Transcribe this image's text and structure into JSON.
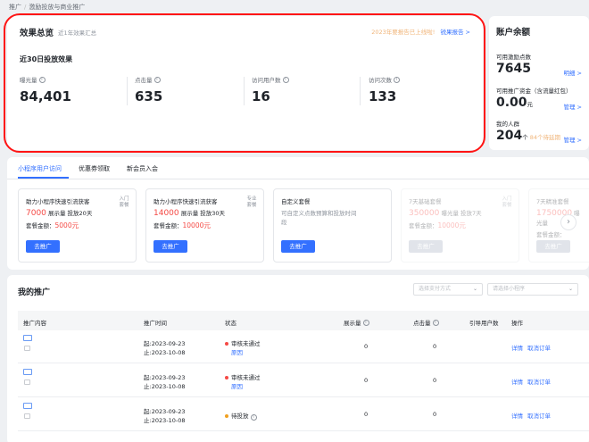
{
  "breadcrumb": {
    "root": "推广",
    "sep": "/",
    "current": "激励投放与商业推广"
  },
  "overview": {
    "title": "效果总览",
    "subtitle": "近1年效果汇总",
    "annual_tip": "2023年要报告已上线啦!",
    "annual_link": "锐果报告 >",
    "period_title": "近30日投放效果",
    "metrics": [
      {
        "label": "曝光量",
        "value": "84,401"
      },
      {
        "label": "点击量",
        "value": "635"
      },
      {
        "label": "访问用户数",
        "value": "16"
      },
      {
        "label": "访问次数",
        "value": "133"
      }
    ]
  },
  "balance": {
    "title": "账户余额",
    "points_label": "可用激励点数",
    "points_value": "7645",
    "points_link": "明细 >",
    "funds_label": "可用推广资金（含流量红包）",
    "funds_value": "0.00",
    "funds_unit": "元",
    "funds_link": "管理 >",
    "invites_label": "我的人群",
    "invites_value": "204",
    "invites_unit": "个",
    "invites_pending": "84个待延期",
    "invites_link": "管理 >"
  },
  "promo_tabs": {
    "tabs": [
      "小程序用户访问",
      "优惠券领取",
      "新会员入会"
    ]
  },
  "packages": [
    {
      "title": "助力小程序快速引流获客",
      "tag": "入门套餐",
      "views": "7000",
      "views_suffix": "展示量 投放20天",
      "amount_label": "套餐金额：",
      "amount": "5000元",
      "button": "去推广"
    },
    {
      "title": "助力小程序快速引流获客",
      "tag": "专业套餐",
      "views": "14000",
      "views_suffix": "展示量 投放30天",
      "amount_label": "套餐金额：",
      "amount": "10000元",
      "button": "去推广"
    },
    {
      "title": "自定义套餐",
      "desc": "可自定义点数预算和投放时间段",
      "button": "去推广"
    },
    {
      "title": "7天基础套餐",
      "tag": "入门套餐",
      "views": "350000",
      "views_suffix": "曝光量 投放7天",
      "amount_label": "套餐金额：",
      "amount": "10000元",
      "button": "去推广"
    },
    {
      "title": "7天精准套餐",
      "views": "1750000",
      "views_suffix": "曝光量",
      "amount_label": "套餐金额：",
      "amount": "",
      "button": "去推广"
    }
  ],
  "my_promotions": {
    "title": "我的推广",
    "select_payment_placeholder": "选择支付方式",
    "select_app_placeholder": "请选择小程序",
    "columns": [
      "推广内容",
      "推广时间",
      "状态",
      "展示量",
      "点击量",
      "引导用户数",
      "操作"
    ],
    "rows": [
      {
        "start": "起:2023-09-23",
        "end": "止:2023-10-08",
        "status": "审核未通过",
        "status_link": "原因",
        "status_color": "#f54a45",
        "impressions": "0",
        "clicks": "0",
        "action1": "详情",
        "action2": "取消订单"
      },
      {
        "start": "起:2023-09-23",
        "end": "止:2023-10-08",
        "status": "审核未通过",
        "status_link": "原因",
        "status_color": "#f54a45",
        "impressions": "0",
        "clicks": "0",
        "action1": "详情",
        "action2": "取消订单"
      },
      {
        "start": "起:2023-09-23",
        "end": "止:2023-10-08",
        "status": "待投放",
        "status_link": "",
        "status_color": "#f0a020",
        "impressions": "0",
        "clicks": "0",
        "action1": "详情",
        "action2": "取消订单"
      }
    ]
  }
}
